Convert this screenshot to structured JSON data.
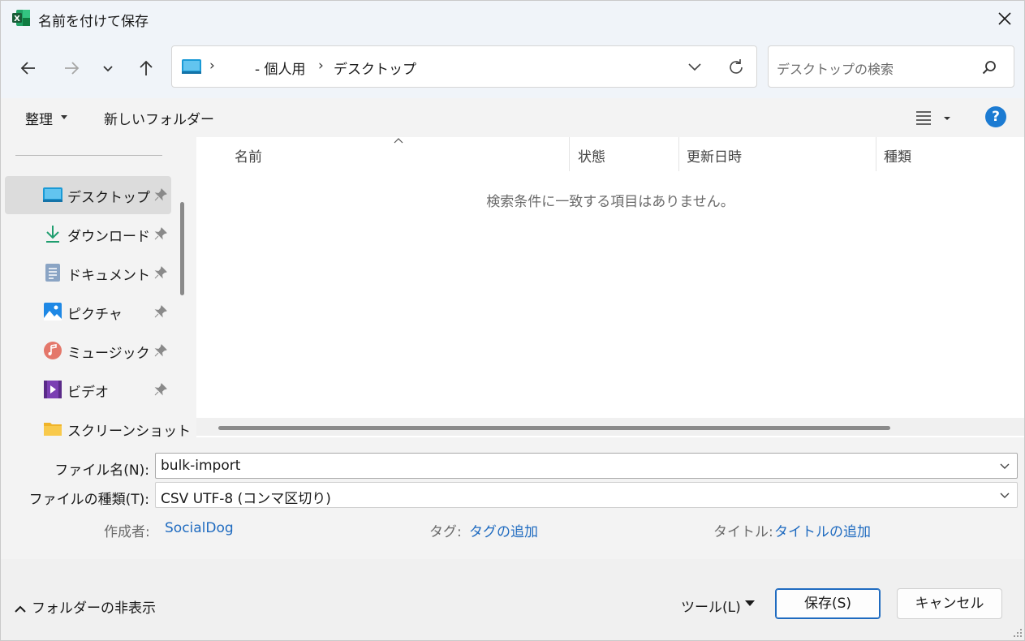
{
  "window": {
    "title": "名前を付けて保存",
    "app_icon": "excel-icon"
  },
  "nav": {
    "back_icon": "back-arrow-icon",
    "forward_icon": "forward-arrow-icon",
    "recent_icon": "chevron-down-icon",
    "up_icon": "up-arrow-icon",
    "breadcrumb": [
      "- 個人用",
      "デスクトップ"
    ],
    "search_placeholder": "デスクトップの検索"
  },
  "commandbar": {
    "organize_label": "整理",
    "new_folder_label": "新しいフォルダー",
    "help_label": "?"
  },
  "sidebar": {
    "items": [
      {
        "label": "デスクトップ",
        "icon": "desktop-icon",
        "pinned": true,
        "selected": true
      },
      {
        "label": "ダウンロード",
        "icon": "download-icon",
        "pinned": true
      },
      {
        "label": "ドキュメント",
        "icon": "document-icon",
        "pinned": true
      },
      {
        "label": "ピクチャ",
        "icon": "pictures-icon",
        "pinned": true
      },
      {
        "label": "ミュージック",
        "icon": "music-icon",
        "pinned": true
      },
      {
        "label": "ビデオ",
        "icon": "video-icon",
        "pinned": true
      },
      {
        "label": "スクリーンショット",
        "icon": "folder-icon",
        "pinned": false
      }
    ]
  },
  "filelist": {
    "columns": [
      "名前",
      "状態",
      "更新日時",
      "種類"
    ],
    "empty_message": "検索条件に一致する項目はありません。"
  },
  "form": {
    "filename_label": "ファイル名(N):",
    "filename_value": "bulk-import",
    "filetype_label": "ファイルの種類(T):",
    "filetype_value": "CSV UTF-8 (コンマ区切り)",
    "author_label": "作成者:",
    "author_value": "SocialDog",
    "tags_label": "タグ:",
    "tags_value": "タグの追加",
    "title_label": "タイトル:",
    "title_value": "タイトルの追加"
  },
  "footer": {
    "hide_folders_label": "フォルダーの非表示",
    "tools_label": "ツール(L)",
    "save_label": "保存(S)",
    "cancel_label": "キャンセル"
  },
  "colors": {
    "accent": "#1f6bc0",
    "help_bg": "#1c7bd2",
    "excel_green": "#1d6f42"
  }
}
